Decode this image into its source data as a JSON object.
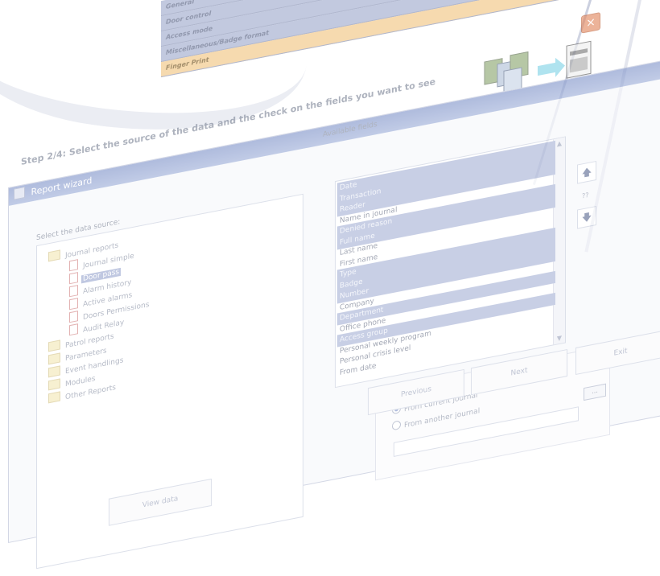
{
  "window_title": "Report wizard",
  "step_title": "Step 2/4: Select the source of the data and the check on the fields you want to see",
  "background_list": [
    {
      "label": "General",
      "selected": false
    },
    {
      "label": "Door control",
      "selected": false
    },
    {
      "label": "Access mode",
      "selected": false
    },
    {
      "label": "Miscellaneous/Badge format",
      "selected": false
    },
    {
      "label": "Finger Print",
      "selected": true
    }
  ],
  "close_label": "×",
  "data_source": {
    "label": "Select the data source:",
    "tree": [
      {
        "label": "Journal reports",
        "icon": "folder-icon",
        "level": 0,
        "selected": false
      },
      {
        "label": "Journal simple",
        "icon": "report-icon",
        "level": 1,
        "selected": false
      },
      {
        "label": "Door pass",
        "icon": "report-icon",
        "level": 1,
        "selected": true
      },
      {
        "label": "Alarm history",
        "icon": "report-icon",
        "level": 1,
        "selected": false
      },
      {
        "label": "Active alarms",
        "icon": "report-icon",
        "level": 1,
        "selected": false
      },
      {
        "label": "Doors Permissions",
        "icon": "report-icon",
        "level": 1,
        "selected": false
      },
      {
        "label": "Audit Relay",
        "icon": "report-icon",
        "level": 1,
        "selected": false
      },
      {
        "label": "Patrol reports",
        "icon": "folder-icon",
        "level": 0,
        "selected": false
      },
      {
        "label": "Parameters",
        "icon": "folder-icon",
        "level": 0,
        "selected": false
      },
      {
        "label": "Event handlings",
        "icon": "folder-icon",
        "level": 0,
        "selected": false
      },
      {
        "label": "Modules",
        "icon": "folder-icon",
        "level": 0,
        "selected": false
      },
      {
        "label": "Other Reports",
        "icon": "folder-icon",
        "level": 0,
        "selected": false
      }
    ]
  },
  "fields": {
    "label": "Available fields",
    "items": [
      {
        "label": "Date",
        "checked": true
      },
      {
        "label": "Transaction",
        "checked": true
      },
      {
        "label": "Reader",
        "checked": true
      },
      {
        "label": "Name in journal",
        "checked": false
      },
      {
        "label": "Denied reason",
        "checked": true
      },
      {
        "label": "Full name",
        "checked": true
      },
      {
        "label": "Last name",
        "checked": false
      },
      {
        "label": "First name",
        "checked": false
      },
      {
        "label": "Type",
        "checked": true
      },
      {
        "label": "Badge",
        "checked": true
      },
      {
        "label": "Number",
        "checked": true
      },
      {
        "label": "Company",
        "checked": false
      },
      {
        "label": "Department",
        "checked": true
      },
      {
        "label": "Office phone",
        "checked": false
      },
      {
        "label": "Access group",
        "checked": true
      },
      {
        "label": "Personal weekly program",
        "checked": false
      },
      {
        "label": "Personal crisis level",
        "checked": false
      },
      {
        "label": "From date",
        "checked": false
      }
    ],
    "up_arrow": "🡅",
    "down_arrow": "🡇",
    "question_marks": "??"
  },
  "journal": {
    "option_current": "From current journal",
    "option_another": "From another journal",
    "selected": "current",
    "browse_label": "...",
    "path_value": ""
  },
  "buttons": {
    "previous": "Previous",
    "next": "Next",
    "exit": "Exit",
    "view_data": "View data"
  }
}
